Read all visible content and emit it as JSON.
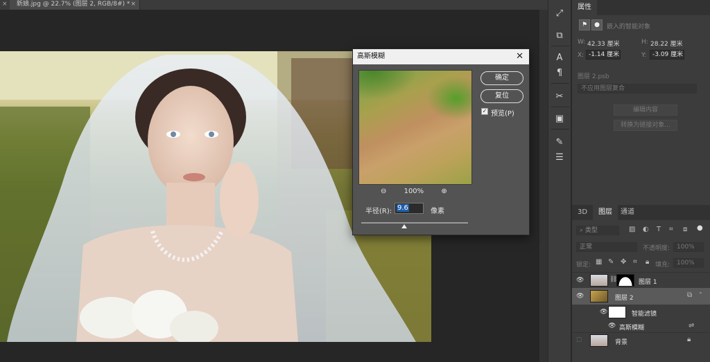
{
  "document": {
    "tab_title": "新娘.jpg @ 22.7% (图层 2, RGB/8#) *",
    "tab_close": "×",
    "left_close": "×"
  },
  "dialog": {
    "title": "高斯模糊",
    "close": "✕",
    "ok": "确定",
    "reset": "复位",
    "preview_checked": true,
    "preview_label": "预览(P)",
    "zoom_out": "⊖",
    "zoom_level": "100%",
    "zoom_in": "⊕",
    "radius_label": "半径(R):",
    "radius_value": "9.6",
    "radius_unit": "像素",
    "radius_fraction": 0.4
  },
  "properties": {
    "tab": "属性",
    "object_type": "嵌入的智能对象",
    "w_label": "W:",
    "w_value": "42.33 厘米",
    "h_label": "H:",
    "h_value": "28.22 厘米",
    "x_label": "X:",
    "x_value": "-1.14 厘米",
    "y_label": "Y:",
    "y_value": "-3.09 厘米",
    "source": "图层 2.psb",
    "comp_dropdown": "不应用图层复合",
    "edit_contents": "编辑内容",
    "convert_linked": "转换为链接对象..."
  },
  "layers": {
    "tabs": [
      "3D",
      "图层",
      "通道"
    ],
    "active_tab": "图层",
    "filter_kind": "类型",
    "blend_mode": "正常",
    "opacity_label": "不透明度:",
    "opacity_value": "100%",
    "lock_label": "锁定:",
    "fill_label": "填充:",
    "fill_value": "100%",
    "items": [
      {
        "name": "图层 1"
      },
      {
        "name": "图层 2"
      },
      {
        "name": "智能滤镜"
      },
      {
        "name": "高斯模糊"
      },
      {
        "name": "背景"
      }
    ]
  },
  "colors": {
    "accent_selection": "#1f5fa8",
    "panel_bg": "#3c3c3c",
    "canvas_bg": "#262626"
  }
}
